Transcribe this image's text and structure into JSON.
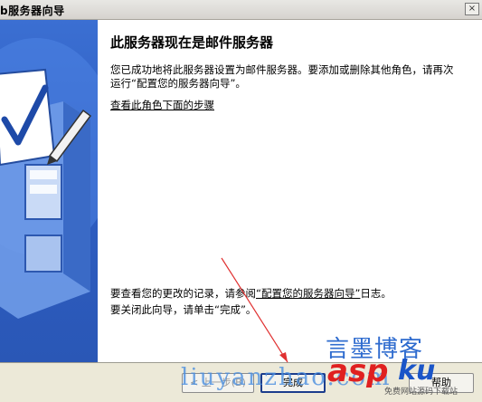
{
  "window": {
    "title": "配置您的服务器向导",
    "visible_title": "b服务器向导",
    "close_glyph": "×"
  },
  "content": {
    "heading": "此服务器现在是邮件服务器",
    "description": "您已成功地将此服务器设置为邮件服务器。要添加或删除其他角色，请再次运行“配置您的服务器向导”。",
    "steps_link": "查看此角色下面的步骤",
    "log_prefix": "要查看您的更改的记录，请参阅",
    "log_link": "“配置您的服务器向导”",
    "log_suffix": "日志。",
    "close_text": "要关闭此向导，请单击“完成”。"
  },
  "buttons": {
    "back": "< 上一步(B)",
    "finish": "完成",
    "help": "帮助"
  },
  "watermarks": {
    "blog": "言墨博客",
    "url": "liuyanzhao.com",
    "asp": "asp",
    "ku": "ku",
    "tagline": "免费网站源码下载站"
  },
  "colors": {
    "side_panel": "#2f5fc4",
    "arrow": "#e03030",
    "finish_border": "#1c3d8c"
  }
}
